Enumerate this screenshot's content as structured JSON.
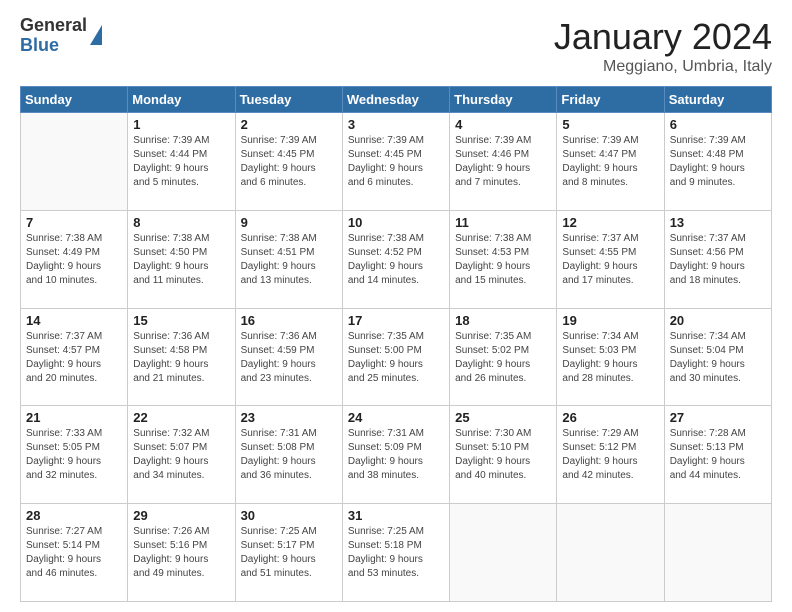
{
  "logo": {
    "general": "General",
    "blue": "Blue"
  },
  "title": "January 2024",
  "location": "Meggiano, Umbria, Italy",
  "weekdays": [
    "Sunday",
    "Monday",
    "Tuesday",
    "Wednesday",
    "Thursday",
    "Friday",
    "Saturday"
  ],
  "weeks": [
    [
      {
        "day": "",
        "info": ""
      },
      {
        "day": "1",
        "info": "Sunrise: 7:39 AM\nSunset: 4:44 PM\nDaylight: 9 hours\nand 5 minutes."
      },
      {
        "day": "2",
        "info": "Sunrise: 7:39 AM\nSunset: 4:45 PM\nDaylight: 9 hours\nand 6 minutes."
      },
      {
        "day": "3",
        "info": "Sunrise: 7:39 AM\nSunset: 4:45 PM\nDaylight: 9 hours\nand 6 minutes."
      },
      {
        "day": "4",
        "info": "Sunrise: 7:39 AM\nSunset: 4:46 PM\nDaylight: 9 hours\nand 7 minutes."
      },
      {
        "day": "5",
        "info": "Sunrise: 7:39 AM\nSunset: 4:47 PM\nDaylight: 9 hours\nand 8 minutes."
      },
      {
        "day": "6",
        "info": "Sunrise: 7:39 AM\nSunset: 4:48 PM\nDaylight: 9 hours\nand 9 minutes."
      }
    ],
    [
      {
        "day": "7",
        "info": "Sunrise: 7:38 AM\nSunset: 4:49 PM\nDaylight: 9 hours\nand 10 minutes."
      },
      {
        "day": "8",
        "info": "Sunrise: 7:38 AM\nSunset: 4:50 PM\nDaylight: 9 hours\nand 11 minutes."
      },
      {
        "day": "9",
        "info": "Sunrise: 7:38 AM\nSunset: 4:51 PM\nDaylight: 9 hours\nand 13 minutes."
      },
      {
        "day": "10",
        "info": "Sunrise: 7:38 AM\nSunset: 4:52 PM\nDaylight: 9 hours\nand 14 minutes."
      },
      {
        "day": "11",
        "info": "Sunrise: 7:38 AM\nSunset: 4:53 PM\nDaylight: 9 hours\nand 15 minutes."
      },
      {
        "day": "12",
        "info": "Sunrise: 7:37 AM\nSunset: 4:55 PM\nDaylight: 9 hours\nand 17 minutes."
      },
      {
        "day": "13",
        "info": "Sunrise: 7:37 AM\nSunset: 4:56 PM\nDaylight: 9 hours\nand 18 minutes."
      }
    ],
    [
      {
        "day": "14",
        "info": "Sunrise: 7:37 AM\nSunset: 4:57 PM\nDaylight: 9 hours\nand 20 minutes."
      },
      {
        "day": "15",
        "info": "Sunrise: 7:36 AM\nSunset: 4:58 PM\nDaylight: 9 hours\nand 21 minutes."
      },
      {
        "day": "16",
        "info": "Sunrise: 7:36 AM\nSunset: 4:59 PM\nDaylight: 9 hours\nand 23 minutes."
      },
      {
        "day": "17",
        "info": "Sunrise: 7:35 AM\nSunset: 5:00 PM\nDaylight: 9 hours\nand 25 minutes."
      },
      {
        "day": "18",
        "info": "Sunrise: 7:35 AM\nSunset: 5:02 PM\nDaylight: 9 hours\nand 26 minutes."
      },
      {
        "day": "19",
        "info": "Sunrise: 7:34 AM\nSunset: 5:03 PM\nDaylight: 9 hours\nand 28 minutes."
      },
      {
        "day": "20",
        "info": "Sunrise: 7:34 AM\nSunset: 5:04 PM\nDaylight: 9 hours\nand 30 minutes."
      }
    ],
    [
      {
        "day": "21",
        "info": "Sunrise: 7:33 AM\nSunset: 5:05 PM\nDaylight: 9 hours\nand 32 minutes."
      },
      {
        "day": "22",
        "info": "Sunrise: 7:32 AM\nSunset: 5:07 PM\nDaylight: 9 hours\nand 34 minutes."
      },
      {
        "day": "23",
        "info": "Sunrise: 7:31 AM\nSunset: 5:08 PM\nDaylight: 9 hours\nand 36 minutes."
      },
      {
        "day": "24",
        "info": "Sunrise: 7:31 AM\nSunset: 5:09 PM\nDaylight: 9 hours\nand 38 minutes."
      },
      {
        "day": "25",
        "info": "Sunrise: 7:30 AM\nSunset: 5:10 PM\nDaylight: 9 hours\nand 40 minutes."
      },
      {
        "day": "26",
        "info": "Sunrise: 7:29 AM\nSunset: 5:12 PM\nDaylight: 9 hours\nand 42 minutes."
      },
      {
        "day": "27",
        "info": "Sunrise: 7:28 AM\nSunset: 5:13 PM\nDaylight: 9 hours\nand 44 minutes."
      }
    ],
    [
      {
        "day": "28",
        "info": "Sunrise: 7:27 AM\nSunset: 5:14 PM\nDaylight: 9 hours\nand 46 minutes."
      },
      {
        "day": "29",
        "info": "Sunrise: 7:26 AM\nSunset: 5:16 PM\nDaylight: 9 hours\nand 49 minutes."
      },
      {
        "day": "30",
        "info": "Sunrise: 7:25 AM\nSunset: 5:17 PM\nDaylight: 9 hours\nand 51 minutes."
      },
      {
        "day": "31",
        "info": "Sunrise: 7:25 AM\nSunset: 5:18 PM\nDaylight: 9 hours\nand 53 minutes."
      },
      {
        "day": "",
        "info": ""
      },
      {
        "day": "",
        "info": ""
      },
      {
        "day": "",
        "info": ""
      }
    ]
  ]
}
